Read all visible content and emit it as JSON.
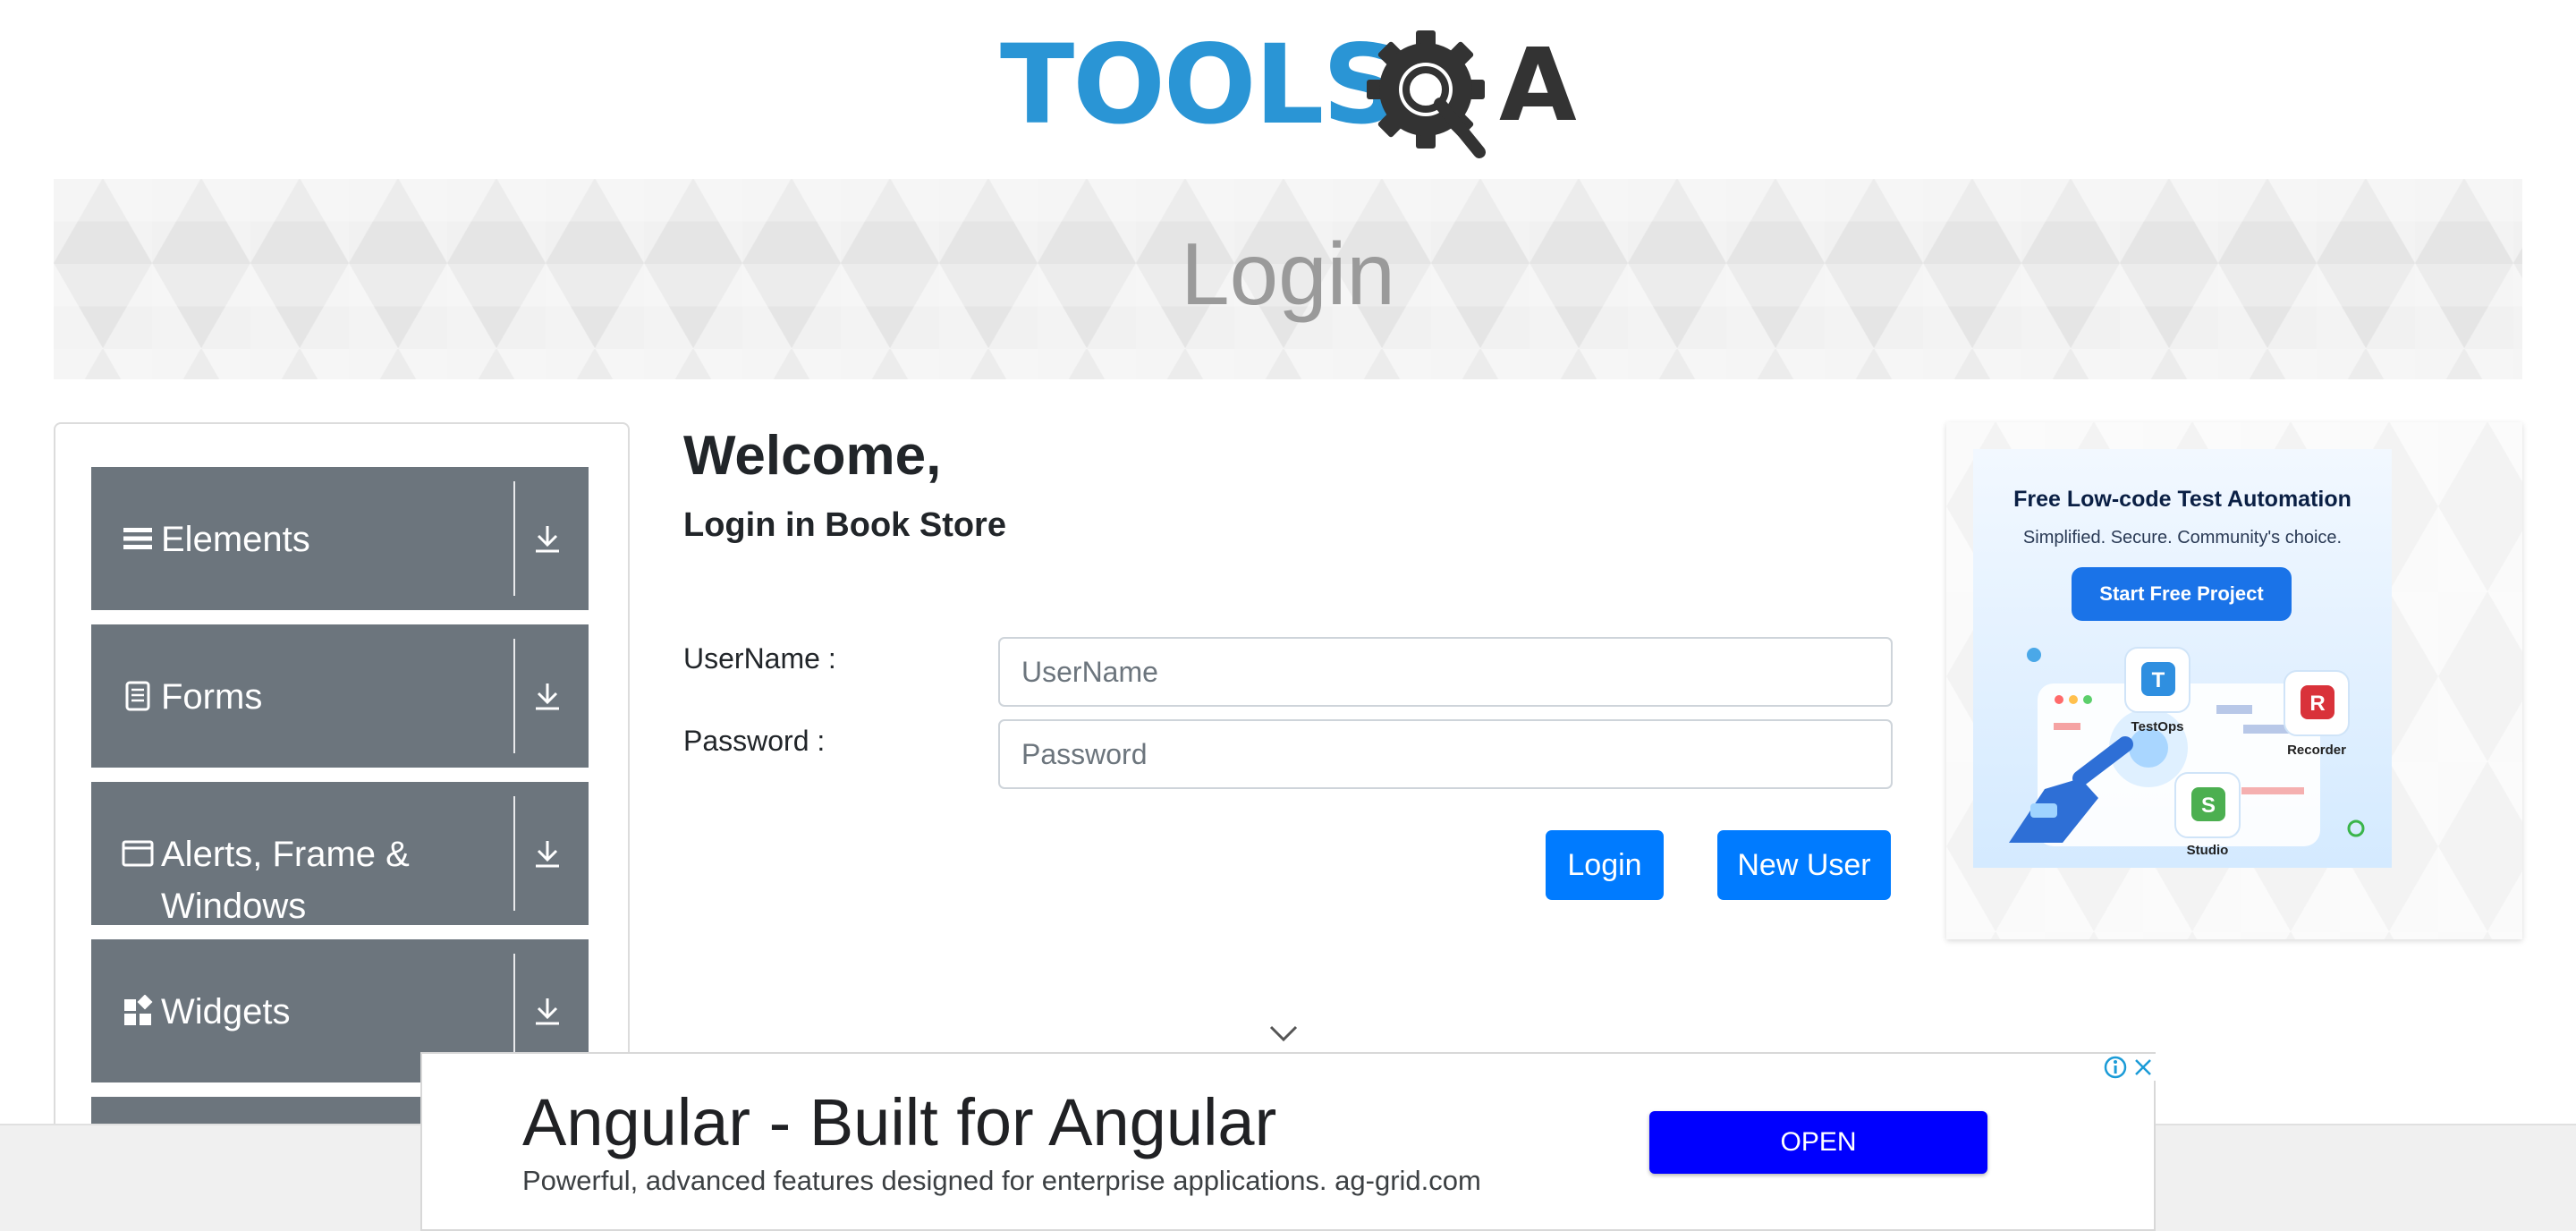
{
  "header": {
    "logo_text": "TOOLS",
    "logo_suffix": "A"
  },
  "banner": {
    "title": "Login"
  },
  "sidebar": {
    "groups": [
      {
        "label": "Elements",
        "icon": "menu-icon"
      },
      {
        "label": "Forms",
        "icon": "document-icon"
      },
      {
        "label": "Alerts, Frame & Windows",
        "icon": "window-icon"
      },
      {
        "label": "Widgets",
        "icon": "widgets-icon"
      }
    ]
  },
  "login": {
    "welcome": "Welcome,",
    "subtitle": "Login in Book Store",
    "username_label": "UserName :",
    "username_placeholder": "UserName",
    "username_value": "",
    "password_label": "Password :",
    "password_placeholder": "Password",
    "password_value": "",
    "login_button": "Login",
    "new_user_button": "New User"
  },
  "side_ad": {
    "headline": "Free Low-code Test Automation",
    "tagline": "Simplified. Secure. Community's choice.",
    "cta": "Start Free Project",
    "apps": [
      {
        "label": "TestOps",
        "letter": "T"
      },
      {
        "label": "Recorder",
        "letter": "R"
      },
      {
        "label": "Studio",
        "letter": "S"
      }
    ]
  },
  "bottom_ad": {
    "title": "Angular - Built for Angular",
    "description": "Powerful, advanced features designed for enterprise applications. ag-grid.com",
    "open_button": "OPEN"
  },
  "colors": {
    "primary": "#007bff",
    "sidebar_group": "#6c757d",
    "logo_blue": "#2a95d5",
    "logo_dark": "#333333",
    "ad_open": "#0000ff"
  }
}
